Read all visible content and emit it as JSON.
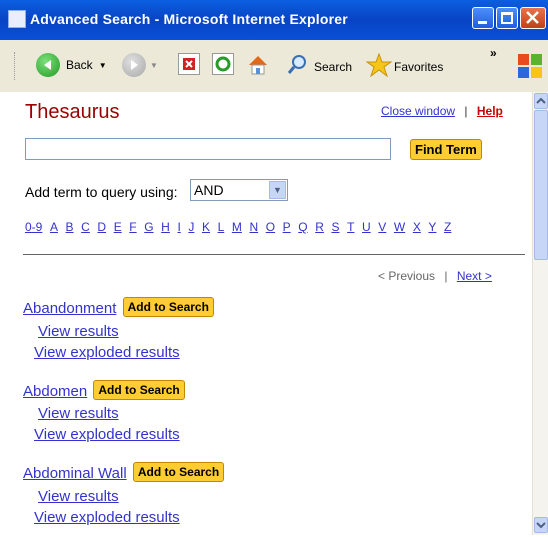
{
  "window": {
    "title": "Advanced Search - Microsoft Internet Explorer"
  },
  "toolbar": {
    "back_label": "Back",
    "search_label": "Search",
    "favorites_label": "Favorites",
    "overflow_label": "»"
  },
  "page": {
    "heading": "Thesaurus",
    "close_window_label": "Close window",
    "separator": "|",
    "help_label": "Help",
    "term_input_value": "",
    "find_term_label": "Find Term",
    "add_term_label": "Add term to query using:",
    "operator_selected": "AND",
    "alphabet": [
      "0-9",
      "A",
      "B",
      "C",
      "D",
      "E",
      "F",
      "G",
      "H",
      "I",
      "J",
      "K",
      "L",
      "M",
      "N",
      "O",
      "P",
      "Q",
      "R",
      "S",
      "T",
      "U",
      "V",
      "W",
      "X",
      "Y",
      "Z"
    ],
    "previous_label": "< Previous",
    "next_label": "Next >",
    "add_to_search_label": "Add to Search",
    "view_results_label": "View results",
    "view_exploded_label": "View exploded results",
    "terms": [
      "Abandonment",
      "Abdomen",
      "Abdominal Wall"
    ]
  },
  "colors": {
    "heading": "#990000",
    "link": "#3333cc",
    "button_yellow": "#ffcc33"
  }
}
